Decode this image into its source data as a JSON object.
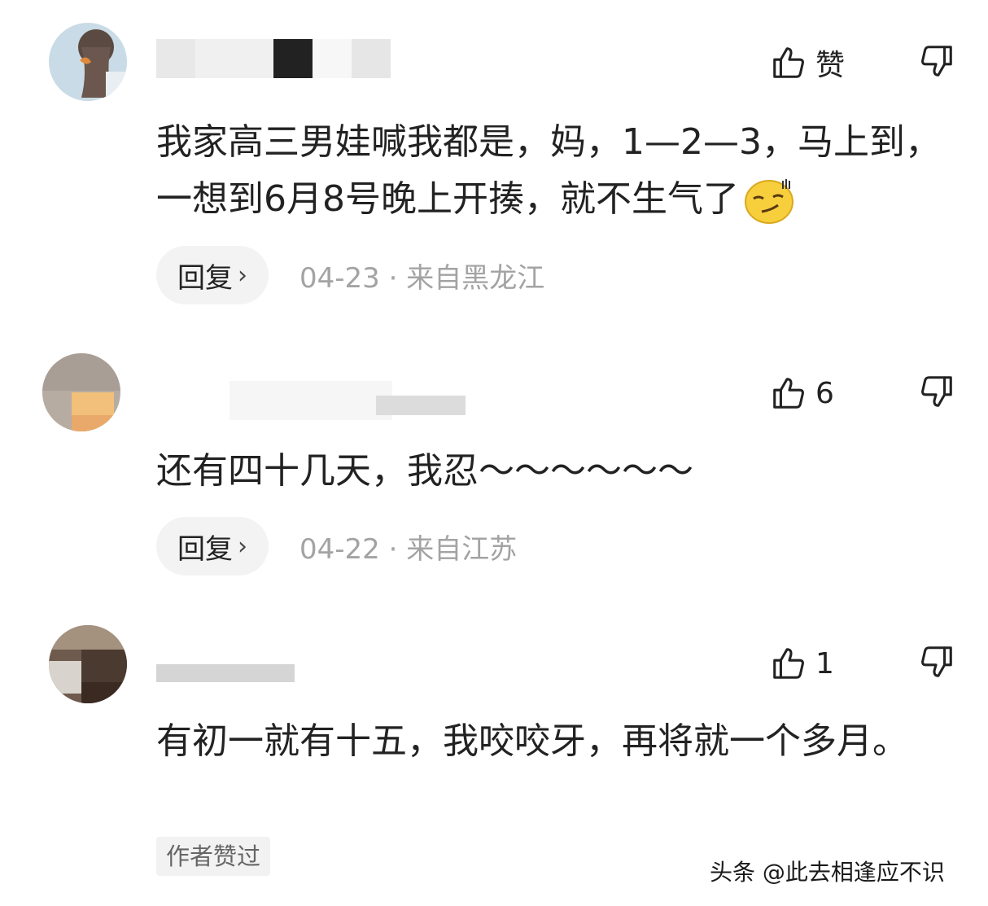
{
  "icons": {
    "like": "thumbs-up-outline-icon",
    "dislike": "thumbs-down-outline-icon",
    "emoji": "smirk-emoji-icon",
    "reply_chevron": "chevron-right-icon"
  },
  "colors": {
    "text": "#222222",
    "meta": "#a3a3a3",
    "reply_bg": "#f3f3f3",
    "tag_bg": "#f2f2f2"
  },
  "comments": [
    {
      "like_label": "赞",
      "text": "我家高三男娃喊我都是，妈，1—2—3，马上到，一想到6月8号晚上开揍，就不生气了",
      "reply_label": "回复",
      "reply_chevron": "›",
      "meta": "04-23 · 来自黑龙江"
    },
    {
      "like_label": "6",
      "text": "还有四十几天，我忍～～～～～～",
      "reply_label": "回复",
      "reply_chevron": "›",
      "meta": "04-22 · 来自江苏"
    },
    {
      "like_label": "1",
      "text": "有初一就有十五，我咬咬牙，再将就一个多月。",
      "author_liked": "作者赞过"
    }
  ],
  "watermark": "头条 @此去相逢应不识"
}
